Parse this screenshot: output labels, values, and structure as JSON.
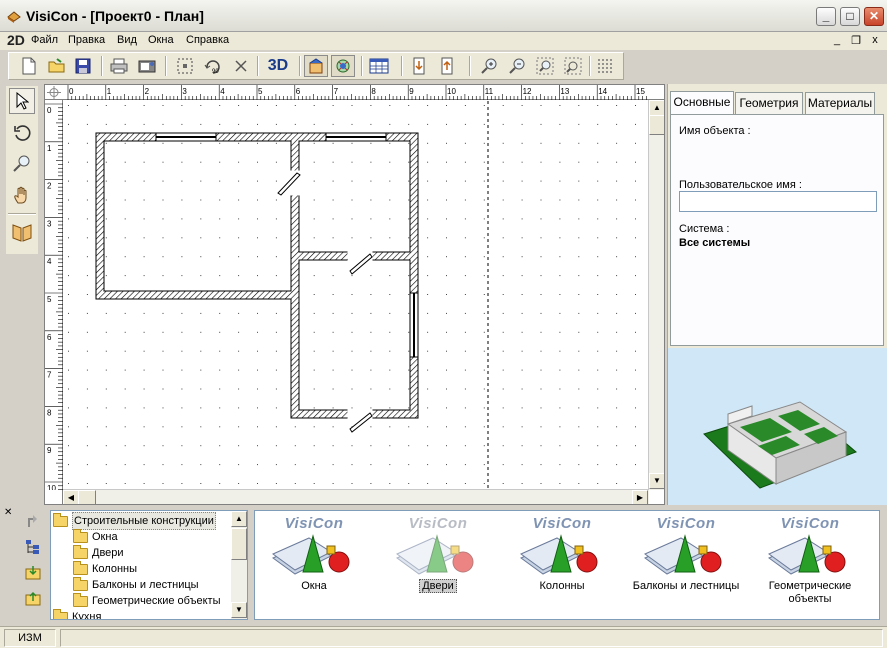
{
  "window": {
    "title": "VisiCon - [Проект0 - План]",
    "minimize": "_",
    "maximize": "□",
    "close": "✕"
  },
  "menubar": {
    "logo": "2D",
    "items": [
      "Файл",
      "Правка",
      "Вид",
      "Окна",
      "Справка"
    ],
    "mdi_minimize": "_",
    "mdi_restore": "❐",
    "mdi_close": "x"
  },
  "toolbar": {
    "three_d_label": "3D",
    "icons": [
      "new-file-icon",
      "open-folder-icon",
      "save-icon",
      "print-icon",
      "print-preview-icon",
      "select-area-icon",
      "rotate-90-icon",
      "delete-icon",
      "3d-view-button",
      "wall-tool-icon",
      "refresh-view-icon",
      "table-icon",
      "move-down-icon",
      "move-up-icon",
      "zoom-in-icon",
      "zoom-out-icon",
      "zoom-fit-icon",
      "zoom-window-icon",
      "grid-icon"
    ]
  },
  "left_tools": [
    "select-arrow-icon",
    "rotate-icon",
    "zoom-icon",
    "pan-hand-icon",
    "mirror-icon"
  ],
  "ruler": {
    "top_labels": [
      "0",
      "1",
      "2",
      "3",
      "4",
      "5",
      "6",
      "7",
      "8",
      "9",
      "10",
      "11",
      "12",
      "13",
      "14",
      "15"
    ],
    "left_labels": [
      "0",
      "1",
      "2",
      "3",
      "4",
      "5",
      "6",
      "7",
      "8",
      "9",
      "10"
    ]
  },
  "properties": {
    "tabs": [
      "Основные",
      "Геометрия",
      "Материалы"
    ],
    "active_tab": "Основные",
    "object_name_label": "Имя объекта :",
    "object_name_value": "",
    "user_name_label": "Пользовательское имя :",
    "user_name_value": "",
    "system_label": "Система :",
    "system_value": "Все системы"
  },
  "tree": {
    "items": [
      {
        "label": "Строительные конструкции",
        "level": 0,
        "selected": true
      },
      {
        "label": "Окна",
        "level": 1
      },
      {
        "label": "Двери",
        "level": 1
      },
      {
        "label": "Колонны",
        "level": 1
      },
      {
        "label": "Балконы и лестницы",
        "level": 1
      },
      {
        "label": "Геометрические объекты",
        "level": 1
      },
      {
        "label": "Кухня",
        "level": 0
      }
    ]
  },
  "gallery": {
    "brand": "VisiCon",
    "items": [
      {
        "caption": "Окна",
        "selected": false
      },
      {
        "caption": "Двери",
        "selected": true
      },
      {
        "caption": "Колонны",
        "selected": false
      },
      {
        "caption": "Балконы и лестницы",
        "selected": false
      },
      {
        "caption": "Геометрические объекты",
        "selected": false
      }
    ]
  },
  "status": {
    "mode": "ИЗМ",
    "message": ""
  },
  "colors": {
    "preview_bg": "#cfe7f7",
    "preview_ground": "#1b7a1b",
    "wall_hatch": "#000000"
  }
}
